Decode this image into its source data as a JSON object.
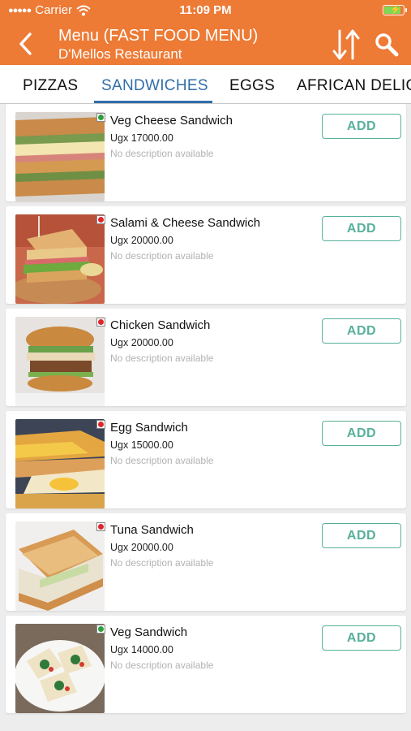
{
  "status_bar": {
    "carrier": "Carrier",
    "time": "11:09 PM"
  },
  "header": {
    "title": "Menu (FAST FOOD MENU)",
    "subtitle": "D'Mellos Restaurant",
    "brand_color": "#ed7a35"
  },
  "tabs": [
    {
      "label": "PIZZAS",
      "active": false
    },
    {
      "label": "SANDWICHES",
      "active": true
    },
    {
      "label": "EGGS",
      "active": false
    },
    {
      "label": "AFRICAN DELIGHTS",
      "active": false
    }
  ],
  "items": [
    {
      "name": "Veg Cheese Sandwich",
      "price": "Ugx 17000.00",
      "description": "No description available",
      "add_label": "ADD",
      "veg": true
    },
    {
      "name": "Salami & Cheese Sandwich",
      "price": "Ugx 20000.00",
      "description": "No description available",
      "add_label": "ADD",
      "veg": false
    },
    {
      "name": "Chicken Sandwich",
      "price": "Ugx 20000.00",
      "description": "No description available",
      "add_label": "ADD",
      "veg": false
    },
    {
      "name": "Egg Sandwich",
      "price": "Ugx 15000.00",
      "description": "No description available",
      "add_label": "ADD",
      "veg": false
    },
    {
      "name": "Tuna Sandwich",
      "price": "Ugx 20000.00",
      "description": "No description available",
      "add_label": "ADD",
      "veg": false
    },
    {
      "name": "Veg Sandwich",
      "price": "Ugx 14000.00",
      "description": "No description available",
      "add_label": "ADD",
      "veg": true
    }
  ],
  "colors": {
    "veg": "#2e9e3e",
    "non_veg": "#e0252b",
    "add": "#57b19a",
    "active_tab": "#2f6ea8"
  }
}
